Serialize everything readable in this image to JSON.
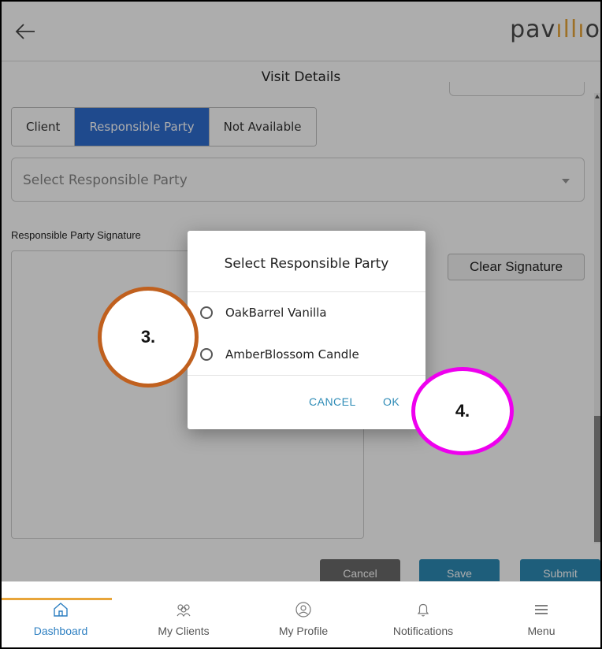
{
  "header": {
    "back_icon": "arrow-left-icon",
    "logo_prefix": "pav",
    "logo_bars": "ıllı",
    "logo_suffix": "o"
  },
  "page": {
    "title": "Visit Details"
  },
  "segmented": {
    "options": [
      "Client",
      "Responsible Party",
      "Not Available"
    ],
    "selected": "Responsible Party"
  },
  "select_responsible_party": {
    "placeholder": "Select Responsible Party"
  },
  "signature": {
    "label": "Responsible Party Signature",
    "clear_label": "Clear Signature"
  },
  "actions": {
    "cancel": "Cancel",
    "save": "Save",
    "submit": "Submit"
  },
  "bottom_nav": {
    "items": [
      {
        "label": "Dashboard",
        "icon": "home-icon",
        "active": true
      },
      {
        "label": "My Clients",
        "icon": "clients-icon",
        "active": false
      },
      {
        "label": "My Profile",
        "icon": "profile-icon",
        "active": false
      },
      {
        "label": "Notifications",
        "icon": "bell-icon",
        "active": false
      },
      {
        "label": "Menu",
        "icon": "hamburger-icon",
        "active": false
      }
    ]
  },
  "dialog": {
    "title": "Select Responsible Party",
    "options": [
      "OakBarrel Vanilla",
      "AmberBlossom Candle"
    ],
    "cancel": "CANCEL",
    "ok": "OK"
  },
  "annotations": {
    "step3": "3.",
    "step4": "4."
  },
  "colors": {
    "accent": "#2d8bb6",
    "segment_active": "#2f6dd0",
    "brand_orange": "#e8a53a",
    "annotation_3_border": "#c0601e",
    "annotation_4_border": "#ee00ee"
  }
}
